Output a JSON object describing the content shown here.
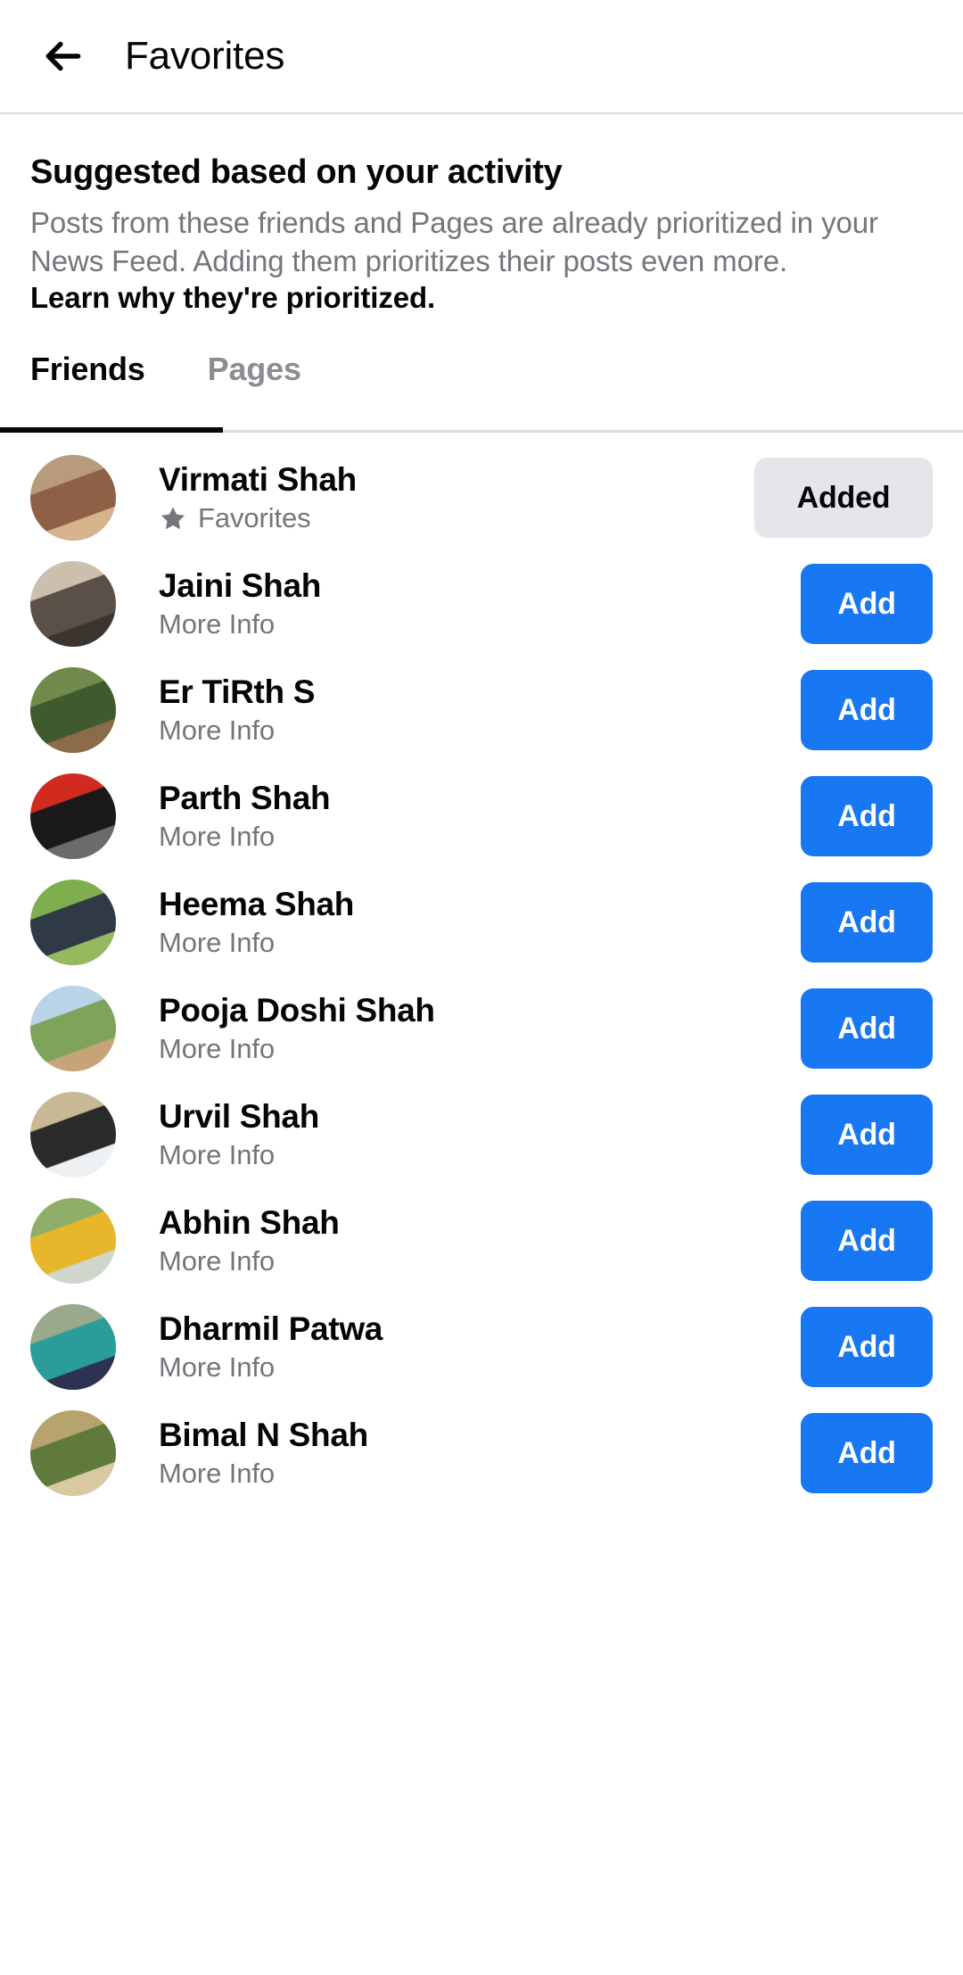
{
  "header": {
    "back_icon": "arrow-left-icon",
    "title": "Favorites"
  },
  "intro": {
    "title": "Suggested based on your activity",
    "body": "Posts from these friends and Pages are already prioritized in your News Feed. Adding them prioritizes their posts even more.",
    "link": "Learn why they're prioritized."
  },
  "tabs": [
    {
      "label": "Friends",
      "active": true
    },
    {
      "label": "Pages",
      "active": false
    }
  ],
  "colors": {
    "primary_button": "#1877F2",
    "secondary_button": "#E4E6EB",
    "text_primary": "#050505",
    "text_secondary": "#73767B",
    "divider": "#DCDEE1"
  },
  "list": [
    {
      "name": "Virmati Shah",
      "subtitle": "Favorites",
      "subtitle_icon": "star-icon",
      "action": "Added",
      "action_state": "added",
      "avatar_colors": [
        "#b89a7d",
        "#8f5f46",
        "#d6b38c"
      ]
    },
    {
      "name": "Jaini Shah",
      "subtitle": "More Info",
      "subtitle_icon": null,
      "action": "Add",
      "action_state": "add",
      "avatar_colors": [
        "#cdbfae",
        "#5b5047",
        "#3b3530"
      ]
    },
    {
      "name": "Er TiRth S",
      "subtitle": "More Info",
      "subtitle_icon": null,
      "action": "Add",
      "action_state": "add",
      "avatar_colors": [
        "#6f8a4a",
        "#3f5a2c",
        "#8a6b4a"
      ]
    },
    {
      "name": "Parth Shah",
      "subtitle": "More Info",
      "subtitle_icon": null,
      "action": "Add",
      "action_state": "add",
      "avatar_colors": [
        "#d12b20",
        "#1a1a1a",
        "#6b6b6b"
      ]
    },
    {
      "name": "Heema Shah",
      "subtitle": "More Info",
      "subtitle_icon": null,
      "action": "Add",
      "action_state": "add",
      "avatar_colors": [
        "#7fae4e",
        "#2f3a46",
        "#96b85e"
      ]
    },
    {
      "name": "Pooja Doshi Shah",
      "subtitle": "More Info",
      "subtitle_icon": null,
      "action": "Add",
      "action_state": "add",
      "avatar_colors": [
        "#b9d4e8",
        "#7ea35a",
        "#c6a477"
      ]
    },
    {
      "name": "Urvil Shah",
      "subtitle": "More Info",
      "subtitle_icon": null,
      "action": "Add",
      "action_state": "add",
      "avatar_colors": [
        "#c9b896",
        "#2b2b2b",
        "#eef1f4"
      ]
    },
    {
      "name": "Abhin Shah",
      "subtitle": "More Info",
      "subtitle_icon": null,
      "action": "Add",
      "action_state": "add",
      "avatar_colors": [
        "#8fae6a",
        "#e8b62b",
        "#cfd6cc"
      ]
    },
    {
      "name": "Dharmil Patwa",
      "subtitle": "More Info",
      "subtitle_icon": null,
      "action": "Add",
      "action_state": "add",
      "avatar_colors": [
        "#9aa88c",
        "#2a9d9a",
        "#2b3350"
      ]
    },
    {
      "name": "Bimal N Shah",
      "subtitle": "More Info",
      "subtitle_icon": null,
      "action": "Add",
      "action_state": "add",
      "avatar_colors": [
        "#b6a36e",
        "#5f7a3a",
        "#d9c9a1"
      ]
    }
  ]
}
